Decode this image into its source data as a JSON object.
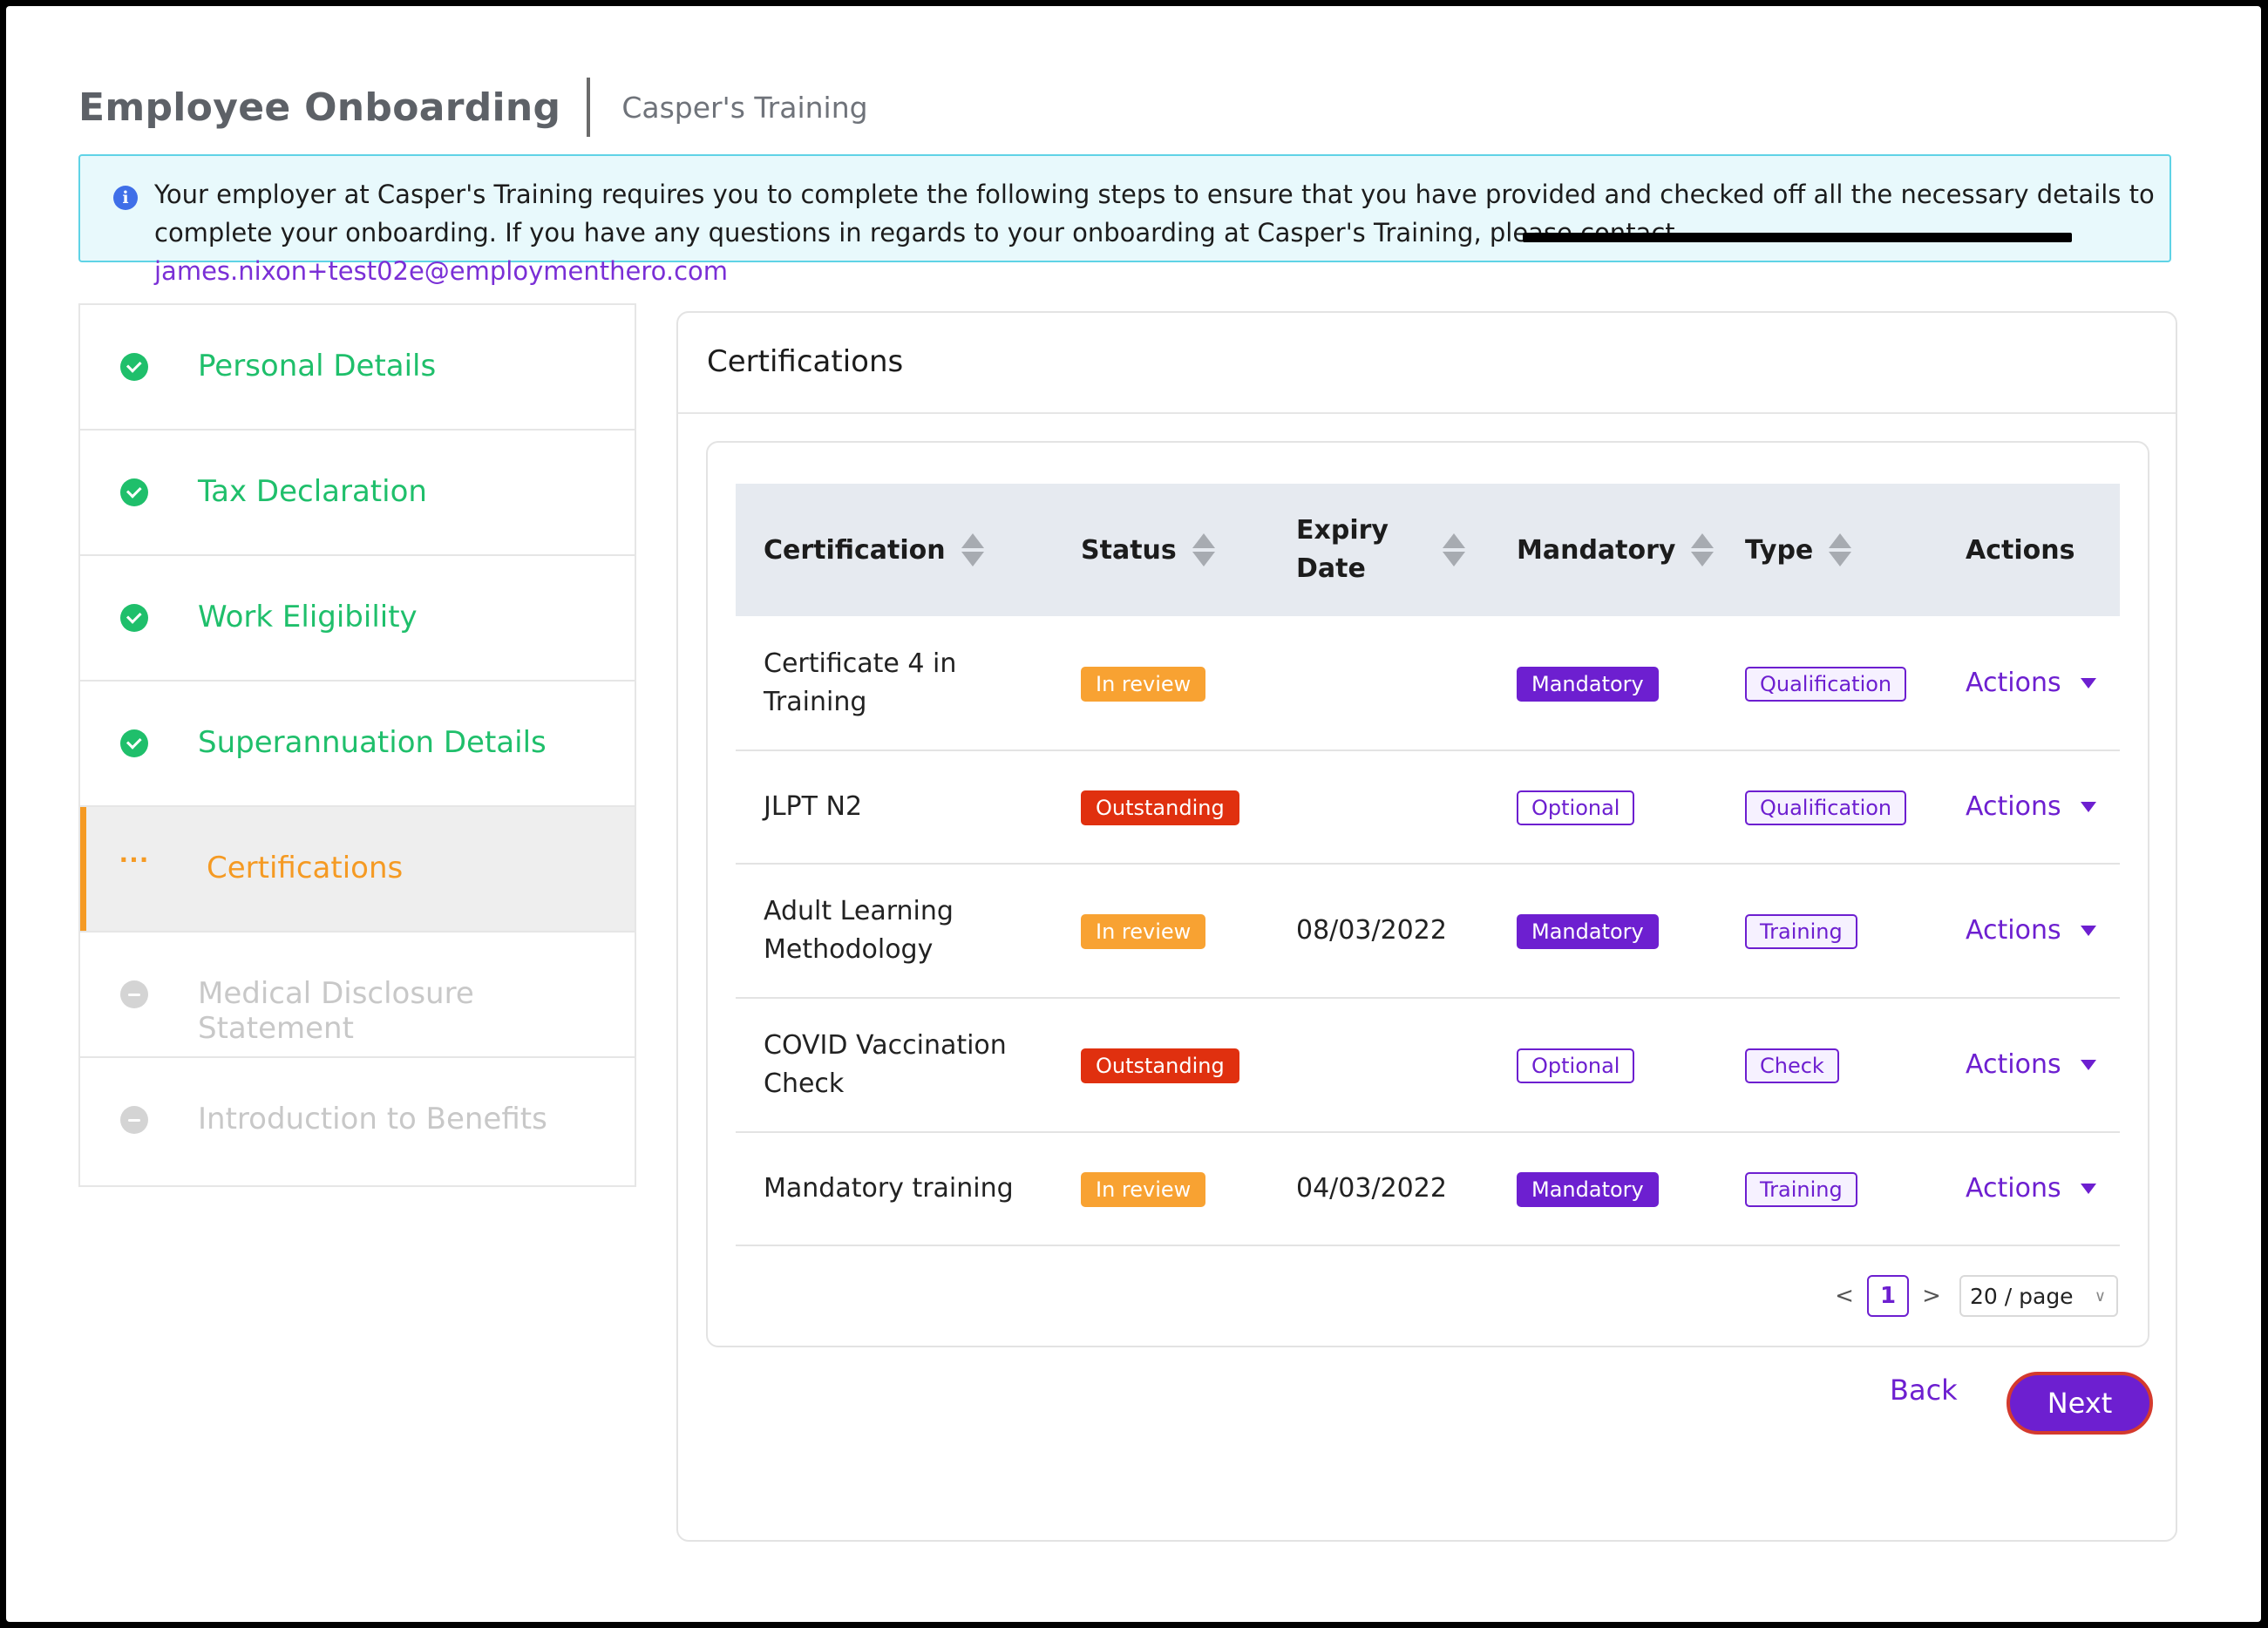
{
  "header": {
    "title": "Employee Onboarding",
    "subtitle": "Casper's Training"
  },
  "banner": {
    "text": "Your employer at Casper's Training requires you to complete the following steps to ensure that you have provided and checked off all the necessary details to complete your onboarding. If you have any questions in regards to your onboarding at Casper's Training, please contact ",
    "email": "james.nixon+test02e@employmenthero.com",
    "icon": "info-icon"
  },
  "steps": [
    {
      "label": "Personal Details",
      "state": "completed"
    },
    {
      "label": "Tax Declaration",
      "state": "completed"
    },
    {
      "label": "Work Eligibility",
      "state": "completed"
    },
    {
      "label": "Superannuation Details",
      "state": "completed"
    },
    {
      "label": "Certifications",
      "state": "current",
      "marker": "···"
    },
    {
      "label": "Medical Disclosure Statement",
      "state": "pending"
    },
    {
      "label": "Introduction to Benefits",
      "state": "pending"
    }
  ],
  "card": {
    "title": "Certifications"
  },
  "table": {
    "columns": {
      "certification": "Certification",
      "status": "Status",
      "expiry": "Expiry Date",
      "mandatory": "Mandatory",
      "type": "Type",
      "actions": "Actions"
    },
    "rows": [
      {
        "certification": "Certificate 4 in Training",
        "status": "In review",
        "expiry": "",
        "mandatory": "Mandatory",
        "type": "Qualification",
        "actions": "Actions"
      },
      {
        "certification": "JLPT N2",
        "status": "Outstanding",
        "expiry": "",
        "mandatory": "Optional",
        "type": "Qualification",
        "actions": "Actions"
      },
      {
        "certification": "Adult Learning Methodology",
        "status": "In review",
        "expiry": "08/03/2022",
        "mandatory": "Mandatory",
        "type": "Training",
        "actions": "Actions"
      },
      {
        "certification": "COVID Vaccination Check",
        "status": "Outstanding",
        "expiry": "",
        "mandatory": "Optional",
        "type": "Check",
        "actions": "Actions"
      },
      {
        "certification": "Mandatory training",
        "status": "In review",
        "expiry": "04/03/2022",
        "mandatory": "Mandatory",
        "type": "Training",
        "actions": "Actions"
      }
    ]
  },
  "pagination": {
    "prev": "<",
    "page": "1",
    "next": ">",
    "page_size": "20 / page"
  },
  "footer": {
    "back_label": "Back",
    "next_label": "Next"
  },
  "colors": {
    "accent": "#6d1fd0",
    "success": "#1fbf6b",
    "current": "#f59a23",
    "review": "#f8a232",
    "outstanding": "#e0300f"
  }
}
